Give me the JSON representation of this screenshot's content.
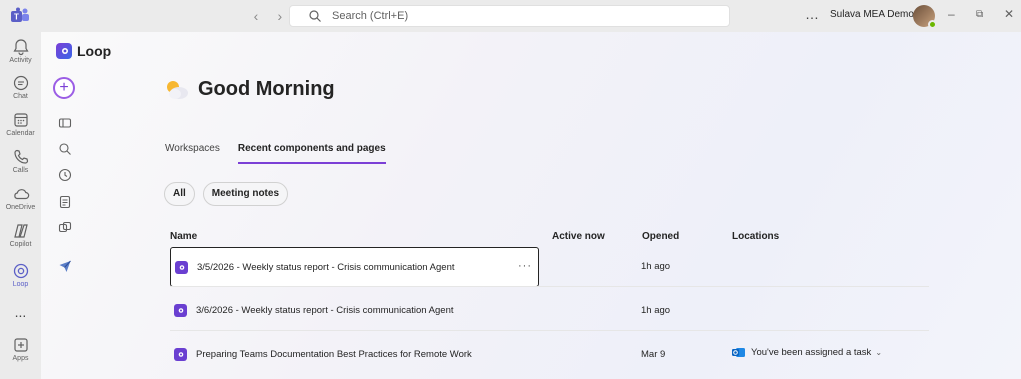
{
  "titlebar": {
    "search_placeholder": "Search (Ctrl+E)",
    "account_name": "Sulava MEA Demo T...",
    "more": "…",
    "back": "‹",
    "forward": "›",
    "minimize": "–",
    "restore": "⧉",
    "close": "✕"
  },
  "rail": {
    "items": [
      {
        "label": "Activity",
        "icon": "bell-icon"
      },
      {
        "label": "Chat",
        "icon": "chat-icon"
      },
      {
        "label": "Calendar",
        "icon": "calendar-icon"
      },
      {
        "label": "Calls",
        "icon": "phone-icon"
      },
      {
        "label": "OneDrive",
        "icon": "cloud-icon"
      },
      {
        "label": "Copilot",
        "icon": "copilot-icon"
      },
      {
        "label": "Loop",
        "icon": "loop-icon",
        "active": true
      },
      {
        "label": "...",
        "icon": "more-icon"
      },
      {
        "label": "Apps",
        "icon": "apps-icon"
      }
    ]
  },
  "loop": {
    "brand": "Loop",
    "new_button": "+",
    "greeting": "Good Morning"
  },
  "tabs": [
    {
      "label": "Workspaces",
      "active": false
    },
    {
      "label": "Recent components and pages",
      "active": true
    }
  ],
  "chips": [
    "All",
    "Meeting notes"
  ],
  "table": {
    "headers": {
      "name": "Name",
      "active_now": "Active now",
      "opened": "Opened",
      "locations": "Locations"
    },
    "rows": [
      {
        "title": "3/5/2026 - Weekly status report - Crisis communication Agent",
        "opened": "1h ago",
        "location": "",
        "selected": true,
        "more": "···"
      },
      {
        "title": "3/6/2026 - Weekly status report - Crisis communication Agent",
        "opened": "1h ago",
        "location": "",
        "selected": false
      },
      {
        "title": "Preparing Teams Documentation Best Practices for Remote Work",
        "opened": "Mar 9",
        "location": "You've been assigned a task",
        "selected": false
      }
    ]
  },
  "colors": {
    "accent": "#7b3fd6",
    "rail_active": "#5b5fc7",
    "presence": "#6bb700"
  }
}
